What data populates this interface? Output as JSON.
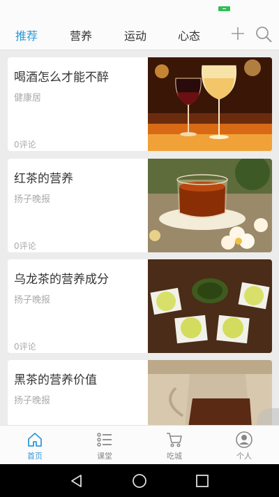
{
  "top_nav": {
    "tabs": [
      {
        "label": "推荐",
        "active": true
      },
      {
        "label": "营养",
        "active": false
      },
      {
        "label": "运动",
        "active": false
      },
      {
        "label": "心态",
        "active": false
      }
    ],
    "add_icon": "plus-icon",
    "search_icon": "search-icon"
  },
  "feed": {
    "articles": [
      {
        "title": "喝酒怎么才能不醉",
        "source": "健康居",
        "comments": "0评论",
        "image": "wine-glasses-image"
      },
      {
        "title": "红茶的营养",
        "source": "扬子晚报",
        "comments": "0评论",
        "image": "black-tea-cup-image"
      },
      {
        "title": "乌龙茶的营养成分",
        "source": "扬子晚报",
        "comments": "0评论",
        "image": "oolong-tea-cups-image"
      },
      {
        "title": "黑茶的营养价值",
        "source": "扬子晚报",
        "comments": "",
        "image": "dark-tea-pot-image"
      }
    ]
  },
  "bottom_nav": {
    "items": [
      {
        "label": "首页",
        "icon": "home-icon",
        "active": true
      },
      {
        "label": "课堂",
        "icon": "list-icon",
        "active": false
      },
      {
        "label": "吃城",
        "icon": "cart-icon",
        "active": false
      },
      {
        "label": "个人",
        "icon": "user-icon",
        "active": false
      }
    ]
  },
  "colors": {
    "accent": "#2f9ad8",
    "background": "#ececec",
    "card": "#ffffff",
    "text": "#333333",
    "muted_text": "#aaaaaa"
  }
}
